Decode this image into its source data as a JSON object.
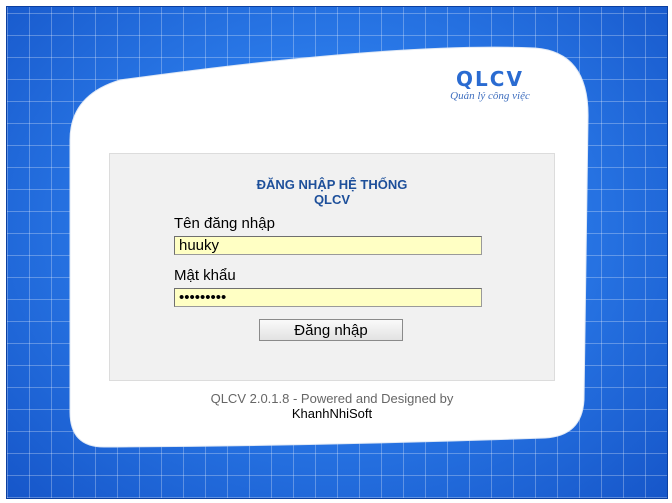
{
  "brand": {
    "title": "QLCV",
    "subtitle": "Quản lý công việc"
  },
  "login": {
    "heading_line1": "ĐĂNG NHẬP HỆ THỐNG",
    "heading_line2": "QLCV",
    "username_label": "Tên đăng nhập",
    "username_value": "huuky",
    "password_label": "Mật khẩu",
    "password_value": "•••••••••",
    "submit_label": "Đăng nhập"
  },
  "footer": {
    "version_text": "QLCV 2.0.1.8 - Powered and Designed by",
    "company": "KhanhNhiSoft"
  },
  "colors": {
    "background_blue": "#1f6fe0",
    "input_bg": "#ffffc4",
    "heading": "#1d4f9a",
    "brand": "#2a6bd1"
  }
}
